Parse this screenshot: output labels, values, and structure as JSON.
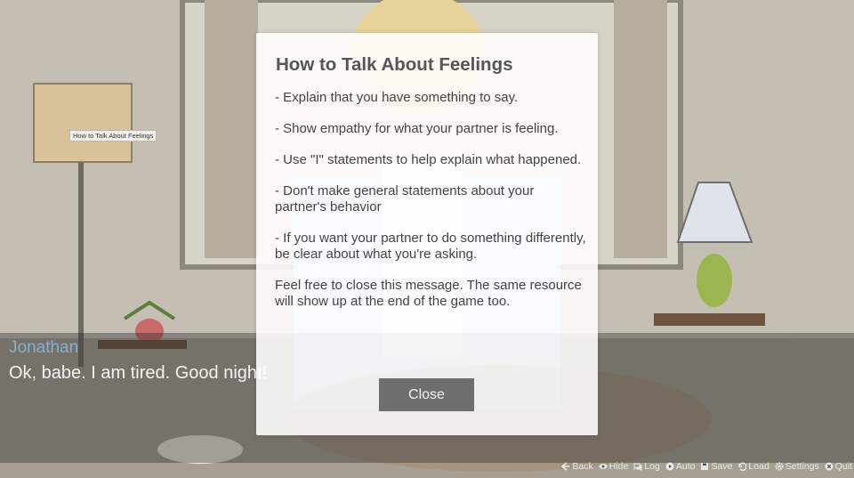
{
  "tooltip": {
    "text": "How to Talk About Feelings"
  },
  "dialogue": {
    "speaker": "Jonathan",
    "line": "Ok, babe. I am tired. Good night!"
  },
  "modal": {
    "title": "How to Talk About Feelings",
    "paragraphs": [
      "- Explain that you have something to say.",
      "- Show empathy for what your partner is feeling.",
      "- Use \"I\" statements to help explain what happened.",
      "- Don't make general statements about your partner's behavior",
      "- If you want your partner to do something differently, be clear about what you're asking.",
      "Feel free to close this message. The same resource will show up at the end of the game too."
    ],
    "close_label": "Close"
  },
  "quick_menu": {
    "items": [
      {
        "label": "Back",
        "icon": "arrow-left-icon"
      },
      {
        "label": "Hide",
        "icon": "eye-icon"
      },
      {
        "label": "Log",
        "icon": "chat-icon"
      },
      {
        "label": "Auto",
        "icon": "play-icon"
      },
      {
        "label": "Save",
        "icon": "floppy-icon"
      },
      {
        "label": "Load",
        "icon": "undo-icon"
      },
      {
        "label": "Settings",
        "icon": "gear-icon"
      },
      {
        "label": "Quit",
        "icon": "close-circle-icon"
      }
    ]
  },
  "colors": {
    "speaker": "#7fb3cf",
    "dialogue_text": "#f4f4f4",
    "button": "#6e6e6e"
  }
}
